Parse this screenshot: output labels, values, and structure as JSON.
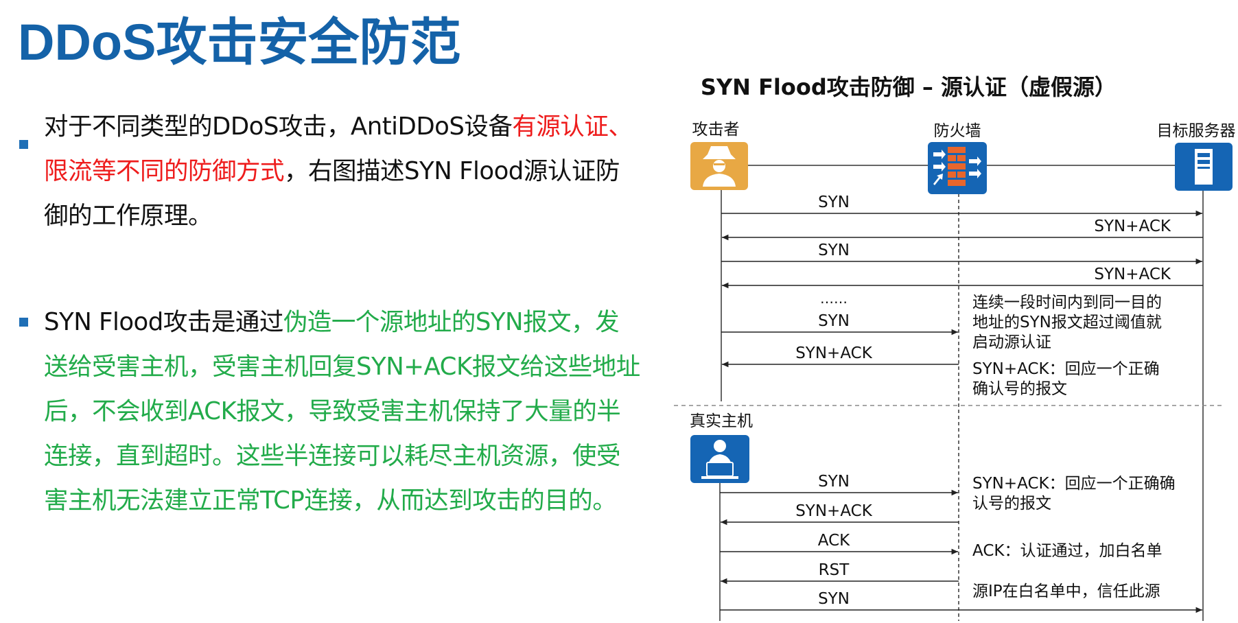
{
  "page": {
    "title": "DDoS攻击安全防范"
  },
  "bullets": [
    {
      "segments": [
        {
          "text": "对于不同类型的DDoS攻击，AntiDDoS设备",
          "style": "normal"
        },
        {
          "text": "有源认证、",
          "style": "red"
        },
        {
          "text": "限流等不同的防御方式",
          "style": "red"
        },
        {
          "text": "，右图描述SYN Flood源认证防",
          "style": "normal"
        },
        {
          "text": "御的工作原理。",
          "style": "normal"
        }
      ]
    },
    {
      "segments": [
        {
          "text": "SYN Flood攻击是通过",
          "style": "normal"
        },
        {
          "text": "伪造一个源地址的SYN报文，发",
          "style": "green"
        },
        {
          "text": "送给受害主机，受害主机回复SYN+ACK报文给这些地址",
          "style": "green"
        },
        {
          "text": "后，不会收到ACK报文，导致受害主机保持了大量的半",
          "style": "green"
        },
        {
          "text": "连接，直到超时。这些半连接可以耗尽主机资源，使受",
          "style": "green"
        },
        {
          "text": "害主机无法建立正常TCP连接，从而达到攻击的目的。",
          "style": "green"
        }
      ]
    }
  ],
  "diagram": {
    "title": "SYN Flood攻击防御 – 源认证（虚假源）",
    "actors": {
      "attacker": "攻击者",
      "firewall": "防火墙",
      "server": "目标服务器",
      "real_host": "真实主机"
    },
    "fake_source_messages": [
      {
        "label": "SYN",
        "from": "attacker",
        "to": "server"
      },
      {
        "label": "SYN+ACK",
        "from": "server",
        "to": "attacker"
      },
      {
        "label": "SYN",
        "from": "attacker",
        "to": "server"
      },
      {
        "label": "SYN+ACK",
        "from": "server",
        "to": "attacker"
      },
      {
        "label": "……",
        "from": "",
        "to": ""
      },
      {
        "label": "SYN",
        "from": "attacker",
        "to": "firewall"
      },
      {
        "label": "SYN+ACK",
        "from": "firewall",
        "to": "attacker"
      }
    ],
    "real_host_messages": [
      {
        "label": "SYN",
        "from": "real_host",
        "to": "firewall"
      },
      {
        "label": "SYN+ACK",
        "from": "firewall",
        "to": "real_host"
      },
      {
        "label": "ACK",
        "from": "real_host",
        "to": "firewall"
      },
      {
        "label": "RST",
        "from": "firewall",
        "to": "real_host"
      },
      {
        "label": "SYN",
        "from": "real_host",
        "to": "server"
      }
    ],
    "notes": [
      "连续一段时间内到同一目的",
      "地址的SYN报文超过阈值就",
      "启动源认证",
      "SYN+ACK：回应一个正确",
      "确认号的报文",
      "SYN+ACK：回应一个正确确",
      "认号的报文",
      "ACK：认证通过，加白名单",
      "源IP在白名单中，信任此源"
    ],
    "colors": {
      "attacker_icon": "#e8a844",
      "firewall_icon": "#1565b4",
      "firewall_bricks": "#e8662c",
      "server_icon": "#1565b4",
      "host_icon": "#1565b4",
      "title_text": "#1462a8"
    },
    "icons": {
      "attacker": "hat-man-icon",
      "firewall": "brick-firewall-icon",
      "server": "server-tower-icon",
      "real_host": "user-laptop-icon"
    }
  }
}
